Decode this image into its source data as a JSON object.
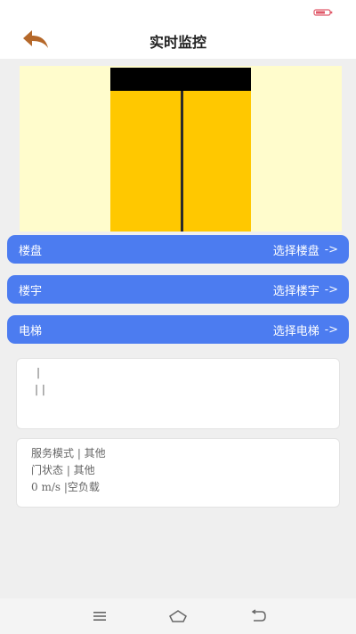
{
  "header": {
    "title": "实时监控",
    "back_icon": "back-arrow-icon",
    "back_color": "#b5682a",
    "status_icon": "battery-icon"
  },
  "elevator": {
    "background": "#fffccc",
    "door_color": "#ffc800",
    "top_color": "#000000"
  },
  "selectors": [
    {
      "label": "楼盘",
      "action": "选择楼盘",
      "arrow": "->"
    },
    {
      "label": "楼宇",
      "action": "选择楼宇",
      "arrow": "->"
    },
    {
      "label": "电梯",
      "action": "选择电梯",
      "arrow": "->"
    }
  ],
  "accent_color": "#4c7cf0",
  "info_card_1": {
    "line1": "|",
    "line2": "| |"
  },
  "info_card_2": {
    "service_mode": "服务模式 | 其他",
    "door_status": "门状态 | 其他",
    "speed_load": "0 m/s |空负载"
  },
  "nav": {
    "menu_icon": "menu-icon",
    "home_icon": "home-icon",
    "back_icon": "back-icon"
  }
}
